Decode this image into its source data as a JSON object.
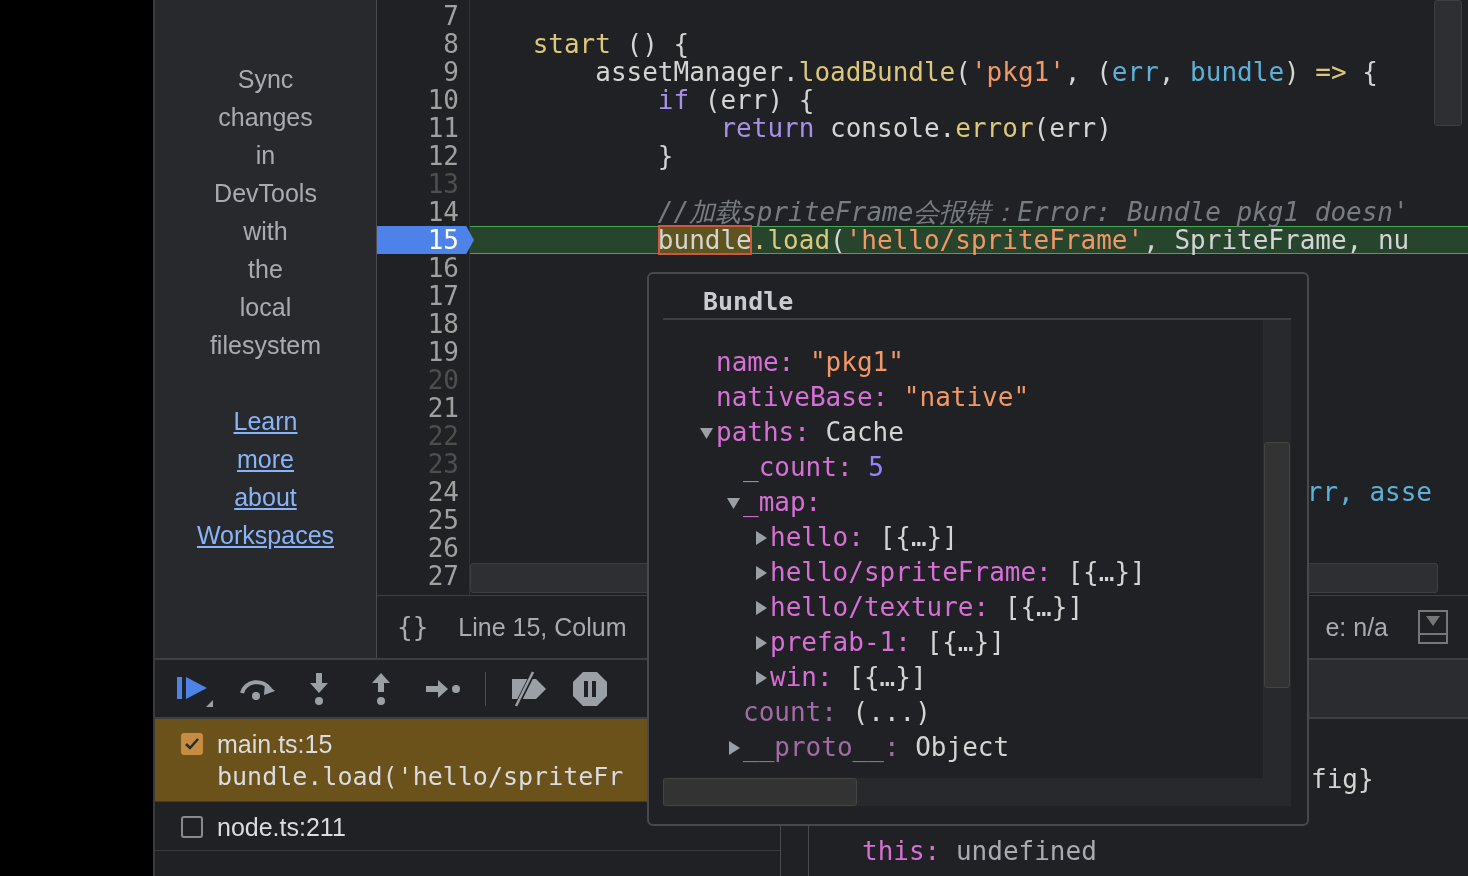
{
  "sidebar": {
    "message": "Sync changes in DevTools with the local filesystem",
    "link": "Learn more about Workspaces"
  },
  "editor": {
    "lines": [
      {
        "number": "7",
        "breakable": true,
        "current": false
      },
      {
        "number": "8",
        "breakable": true,
        "current": false,
        "tokens": [
          {
            "text": "    start",
            "kind": "fn"
          },
          {
            "text": " () {"
          }
        ]
      },
      {
        "number": "9",
        "breakable": true,
        "current": false,
        "tokens": [
          {
            "text": "        assetManager."
          },
          {
            "text": "loadBundle",
            "kind": "fn"
          },
          {
            "text": "("
          },
          {
            "text": "'pkg1'",
            "kind": "string"
          },
          {
            "text": ", ("
          },
          {
            "text": "err",
            "kind": "param"
          },
          {
            "text": ", "
          },
          {
            "text": "bundle",
            "kind": "param"
          },
          {
            "text": ") "
          },
          {
            "text": "=>",
            "kind": "fn"
          },
          {
            "text": " {"
          }
        ]
      },
      {
        "number": "10",
        "breakable": true,
        "current": false,
        "tokens": [
          {
            "text": "            if",
            "kind": "keyword"
          },
          {
            "text": " (err) {"
          }
        ]
      },
      {
        "number": "11",
        "breakable": true,
        "current": false,
        "tokens": [
          {
            "text": "                return",
            "kind": "keyword"
          },
          {
            "text": " console."
          },
          {
            "text": "error",
            "kind": "fn"
          },
          {
            "text": "(err)"
          }
        ]
      },
      {
        "number": "12",
        "breakable": true,
        "current": false,
        "tokens": [
          {
            "text": "            }"
          }
        ]
      },
      {
        "number": "13",
        "breakable": false,
        "current": false
      },
      {
        "number": "14",
        "breakable": true,
        "current": false,
        "tokens": [
          {
            "text": "            //加载spriteFrame会报错：Error: Bundle pkg1 doesn'",
            "kind": "comment"
          }
        ]
      },
      {
        "number": "15",
        "breakable": true,
        "current": true,
        "tokens": [
          {
            "text": "            bundle",
            "highlighted": true
          },
          {
            "text": ".load",
            "kind": "fn",
            "highlighted": false
          },
          {
            "text": "(",
            "highlighted": false
          },
          {
            "text": "'hello/spriteFrame'",
            "kind": "string",
            "highlighted": false
          },
          {
            "text": ", SpriteFrame, nu",
            "highlighted": false
          }
        ]
      },
      {
        "number": "16",
        "breakable": true,
        "current": false
      },
      {
        "number": "17",
        "breakable": true,
        "current": false
      },
      {
        "number": "18",
        "breakable": true,
        "current": false
      },
      {
        "number": "19",
        "breakable": true,
        "current": false
      },
      {
        "number": "20",
        "breakable": false,
        "current": false
      },
      {
        "number": "21",
        "breakable": true,
        "current": false
      },
      {
        "number": "22",
        "breakable": false,
        "current": false
      },
      {
        "number": "23",
        "breakable": false,
        "current": false
      },
      {
        "number": "24",
        "breakable": true,
        "current": false,
        "kind": "fragment",
        "tokens": [
          {
            "text": "rr, asse",
            "kind": "param"
          }
        ]
      },
      {
        "number": "25",
        "breakable": true,
        "current": false
      },
      {
        "number": "26",
        "breakable": true,
        "current": false
      },
      {
        "number": "27",
        "breakable": true,
        "current": false
      }
    ]
  },
  "status_bar": {
    "format_icon": "{}",
    "position": "Line 15, Colum",
    "coverage": "e: n/a"
  },
  "breakpoints": [
    {
      "file": "main.ts:15",
      "code": "bundle.load('hello/spriteFr",
      "checked": true,
      "selected": true
    },
    {
      "file": "node.ts:211",
      "checked": false,
      "selected": false
    }
  ],
  "scope": {
    "rows": [
      {
        "kind": "fragment",
        "value": "fig}"
      },
      {
        "kind": "property",
        "key": "this:",
        "value": "undefined"
      }
    ]
  },
  "popover": {
    "title": "Bundle",
    "properties": [
      {
        "key": "name:",
        "value": "\"pkg1\"",
        "kind": "string",
        "enumerable": true
      },
      {
        "key": "nativeBase:",
        "value": "\"native\"",
        "kind": "string",
        "enumerable": true
      },
      {
        "key": "paths:",
        "value": "Cache",
        "kind": "object",
        "enumerable": true,
        "expanded": true,
        "children": [
          {
            "key": "_count:",
            "value": "5",
            "kind": "number",
            "enumerable": true
          },
          {
            "key": "_map:",
            "enumerable": true,
            "expanded": true,
            "children": [
              {
                "key": "hello:",
                "value": "[{…}]",
                "kind": "object",
                "enumerable": true,
                "expanded": false
              },
              {
                "key": "hello/spriteFrame:",
                "value": "[{…}]",
                "kind": "object",
                "enumerable": true,
                "expanded": false
              },
              {
                "key": "hello/texture:",
                "value": "[{…}]",
                "kind": "object",
                "enumerable": true,
                "expanded": false
              },
              {
                "key": "prefab-1:",
                "value": "[{…}]",
                "kind": "object",
                "enumerable": true,
                "expanded": false
              },
              {
                "key": "win:",
                "value": "[{…}]",
                "kind": "object",
                "enumerable": true,
                "expanded": false
              }
            ]
          },
          {
            "key": "count:",
            "value": "(...)",
            "kind": "getter",
            "enumerable": false
          },
          {
            "key": "__proto__:",
            "value": "Object",
            "kind": "object",
            "enumerable": false,
            "expanded": false
          }
        ]
      }
    ]
  }
}
